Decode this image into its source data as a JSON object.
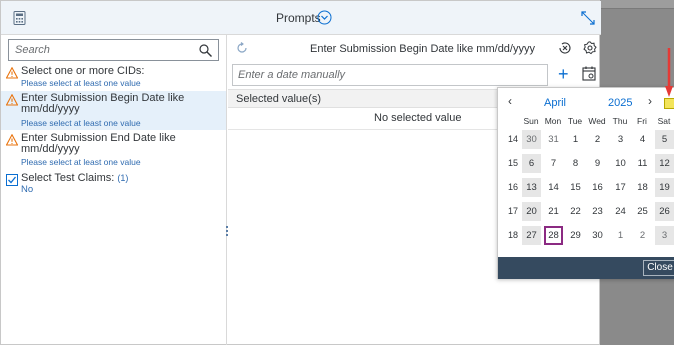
{
  "header": {
    "title": "Prompts"
  },
  "search": {
    "placeholder": "Search"
  },
  "left_items": [
    {
      "label": "Select one or more CIDs:",
      "hint": "Please select at least one value",
      "status": "warning"
    },
    {
      "label": "Enter Submission Begin Date like mm/dd/yyyy",
      "hint": "Please select at least one value",
      "status": "warning",
      "selected": true
    },
    {
      "label": "Enter Submission End Date like mm/dd/yyyy",
      "hint": "Please select at least one value",
      "status": "warning"
    },
    {
      "label": "Select Test Claims:",
      "count": "(1)",
      "value": "No",
      "status": "done"
    }
  ],
  "main": {
    "prompt_title": "Enter Submission Begin Date like mm/dd/yyyy",
    "date_placeholder": "Enter a date manually",
    "selected_header": "Selected value(s)",
    "no_selection": "No selected value"
  },
  "calendar": {
    "month": "April",
    "year": "2025",
    "weekdays": [
      "Sun",
      "Mon",
      "Tue",
      "Wed",
      "Thu",
      "Fri",
      "Sat"
    ],
    "weeks": [
      {
        "num": "14",
        "days": [
          "30",
          "31",
          "1",
          "2",
          "3",
          "4",
          "5"
        ]
      },
      {
        "num": "15",
        "days": [
          "6",
          "7",
          "8",
          "9",
          "10",
          "11",
          "12"
        ]
      },
      {
        "num": "16",
        "days": [
          "13",
          "14",
          "15",
          "16",
          "17",
          "18",
          "19"
        ]
      },
      {
        "num": "17",
        "days": [
          "20",
          "21",
          "22",
          "23",
          "24",
          "25",
          "26"
        ]
      },
      {
        "num": "18",
        "days": [
          "27",
          "28",
          "29",
          "30",
          "1",
          "2",
          "3"
        ]
      }
    ],
    "today": "28",
    "close_label": "Close"
  },
  "colors": {
    "accent": "#0a6ed1",
    "warning": "#e9730c",
    "today_border": "#8b2a82",
    "arrow": "#e53935"
  }
}
